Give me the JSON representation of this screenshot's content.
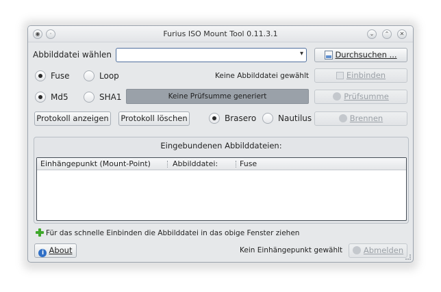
{
  "window": {
    "title": "Furius ISO Mount Tool 0.11.3.1"
  },
  "image_row": {
    "label": "Abbilddatei wählen",
    "combo_value": "",
    "browse_label": "Durchsuchen ..."
  },
  "mount_row": {
    "fuse": "Fuse",
    "loop": "Loop",
    "status": "Keine Abbilddatei gewählt",
    "mount_label": "Einbinden"
  },
  "checksum_row": {
    "md5": "Md5",
    "sha1": "SHA1",
    "status": "Keine Prüfsumme generiert",
    "checksum_label": "Prüfsumme"
  },
  "log_row": {
    "show_log": "Protokoll anzeigen",
    "delete_log": "Protokoll löschen",
    "brasero": "Brasero",
    "nautilus": "Nautilus",
    "burn_label": "Brennen"
  },
  "mounted": {
    "title": "Eingebundenen Abbilddateien:",
    "columns": [
      "Einhängepunkt (Mount-Point)",
      "Abbilddatei:",
      "Fuse"
    ]
  },
  "hint": "Für das schnelle Einbinden die Abbilddatei in das obige Fenster ziehen",
  "footer": {
    "about_label": "About",
    "status": "Kein Einhängepunkt gewählt",
    "unmount_label": "Abmelden"
  },
  "state": {
    "fuse_selected": true,
    "md5_selected": true,
    "brasero_selected": true
  },
  "colors": {
    "accent": "#2f6fc6",
    "checksum_bg": "#9aa1a9",
    "add_icon": "#3fa82b"
  }
}
